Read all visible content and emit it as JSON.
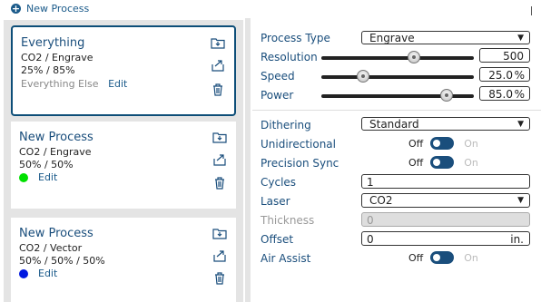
{
  "header": {
    "new_process_label": "New Process"
  },
  "processes": [
    {
      "title": "Everything",
      "line1": "CO2 / Engrave",
      "line2": "25% / 85%",
      "line3_label": "Everything Else",
      "edit_label": "Edit"
    },
    {
      "title": "New Process",
      "line1": "CO2 / Engrave",
      "line2": "50% / 50%",
      "dot_color": "#00e000",
      "edit_label": "Edit"
    },
    {
      "title": "New Process",
      "line1": "CO2 / Vector",
      "line2": "50% / 50% / 50%",
      "dot_color": "#0018e0",
      "edit_label": "Edit"
    }
  ],
  "settings": {
    "process_type": {
      "label": "Process Type",
      "value": "Engrave"
    },
    "resolution": {
      "label": "Resolution",
      "value": "500",
      "level": 0.62
    },
    "speed": {
      "label": "Speed",
      "value": "25.0",
      "unit": "%",
      "level": 0.25
    },
    "power": {
      "label": "Power",
      "value": "85.0",
      "unit": "%",
      "level": 0.85
    },
    "dithering": {
      "label": "Dithering",
      "value": "Standard"
    },
    "unidirectional": {
      "label": "Unidirectional",
      "off": "Off",
      "on": "On"
    },
    "precision_sync": {
      "label": "Precision Sync",
      "off": "Off",
      "on": "On"
    },
    "cycles": {
      "label": "Cycles",
      "value": "1"
    },
    "laser": {
      "label": "Laser",
      "value": "CO2"
    },
    "thickness": {
      "label": "Thickness",
      "value": "0"
    },
    "offset": {
      "label": "Offset",
      "value": "0",
      "unit": "in."
    },
    "air_assist": {
      "label": "Air Assist",
      "off": "Off",
      "on": "On"
    }
  },
  "colors": {
    "accent": "#1a4e7c",
    "panel_bg": "#e4e4e4"
  }
}
